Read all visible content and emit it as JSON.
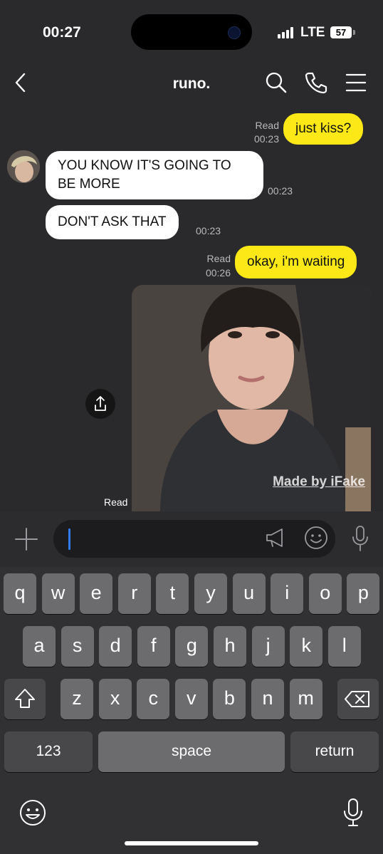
{
  "status_bar": {
    "time": "00:27",
    "network": "LTE",
    "battery": "57"
  },
  "header": {
    "title": "runo."
  },
  "messages": [
    {
      "side": "me",
      "text": "just kiss?",
      "read": "Read",
      "time": "00:23"
    },
    {
      "side": "them",
      "text_line1": "YOU KNOW IT'S GOING TO",
      "text_line2": "BE MORE",
      "time": "00:23"
    },
    {
      "side": "them",
      "text": "DON'T ASK THAT",
      "time": "00:23"
    },
    {
      "side": "me",
      "text": "okay, i'm waiting",
      "read": "Read",
      "time": "00:26"
    },
    {
      "side": "me",
      "type": "photo",
      "watermark": "Made by iFake",
      "read": "Read"
    }
  ],
  "keyboard": {
    "row1": [
      "q",
      "w",
      "e",
      "r",
      "t",
      "y",
      "u",
      "i",
      "o",
      "p"
    ],
    "row2": [
      "a",
      "s",
      "d",
      "f",
      "g",
      "h",
      "j",
      "k",
      "l"
    ],
    "row3": [
      "z",
      "x",
      "c",
      "v",
      "b",
      "n",
      "m"
    ],
    "numbers_label": "123",
    "space_label": "space",
    "return_label": "return"
  },
  "icons": [
    "back-icon",
    "search-icon",
    "phone-icon",
    "menu-icon",
    "share-icon",
    "plus-icon",
    "megaphone-icon",
    "emoji-icon",
    "mic-icon",
    "shift-icon",
    "backspace-icon",
    "keyboard-emoji-icon",
    "dictation-icon"
  ],
  "colors": {
    "my_bubble": "#fbe816",
    "their_bubble": "#ffffff",
    "background": "#2a2a2c",
    "cursor": "#2f7cf6"
  }
}
